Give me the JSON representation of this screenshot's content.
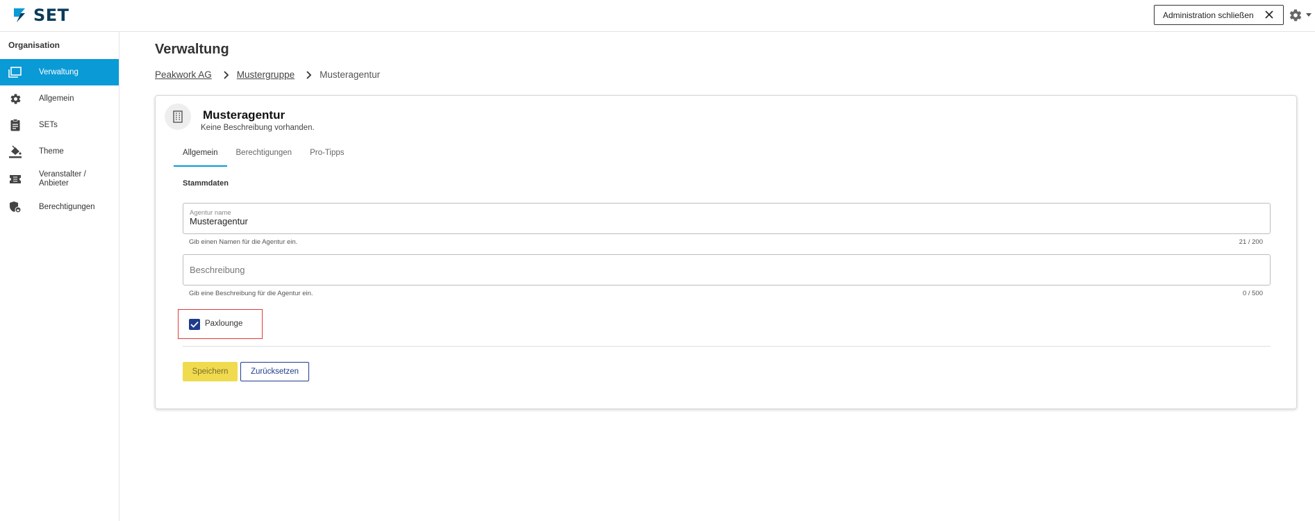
{
  "app": {
    "logo_text": "SET",
    "logo_icon": "set-logo-icon"
  },
  "topbar": {
    "admin_close_label": "Administration schließen",
    "close_icon": "close-icon",
    "settings_icon": "gear-icon"
  },
  "sidebar": {
    "title": "Organisation",
    "items": [
      {
        "label": "Verwaltung",
        "icon": "windows-icon",
        "active": true
      },
      {
        "label": "Allgemein",
        "icon": "gear-icon",
        "active": false
      },
      {
        "label": "SETs",
        "icon": "clipboard-icon",
        "active": false
      },
      {
        "label": "Theme",
        "icon": "paint-bucket-icon",
        "active": false
      },
      {
        "label": "Veranstalter / Anbieter",
        "icon": "ticket-icon",
        "active": false
      },
      {
        "label": "Berechtigungen",
        "icon": "shield-lock-icon",
        "active": false
      }
    ]
  },
  "main": {
    "title": "Verwaltung",
    "breadcrumb": {
      "items": [
        "Peakwork AG",
        "Mustergruppe",
        "Musteragentur"
      ]
    },
    "card": {
      "title": "Musteragentur",
      "subtitle": "Keine Beschreibung vorhanden.",
      "avatar_icon": "building-icon",
      "tabs": [
        {
          "label": "Allgemein",
          "active": true
        },
        {
          "label": "Berechtigungen",
          "active": false
        },
        {
          "label": "Pro-Tipps",
          "active": false
        }
      ],
      "section_label": "Stammdaten",
      "name_field": {
        "label": "Agentur name",
        "value": "Musteragentur",
        "hint": "Gib einen Namen für die Agentur ein.",
        "counter": "21 / 200"
      },
      "description_field": {
        "placeholder": "Beschreibung",
        "value": "",
        "hint": "Gib eine Beschreibung für die Agentur ein.",
        "counter": "0 / 500"
      },
      "checkbox": {
        "label": "Paxlounge",
        "checked": true
      },
      "save_label": "Speichern",
      "reset_label": "Zurücksetzen"
    }
  },
  "colors": {
    "accent": "#0a9ad6",
    "brand_dark": "#0b3b5a",
    "checkbox": "#1f3c8c",
    "save_button": "#f0db4f",
    "highlight_outline": "#e03a3a"
  }
}
